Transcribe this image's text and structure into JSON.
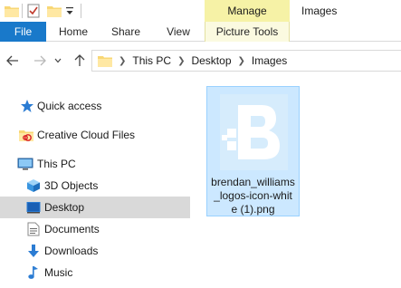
{
  "window": {
    "title": "Images",
    "contextual_group": "Manage"
  },
  "quick_access_toolbar": {
    "items": [
      "folder-icon",
      "properties-check-icon",
      "new-folder-icon",
      "customize-dropdown-icon"
    ]
  },
  "ribbon": {
    "tabs": [
      {
        "label": "File",
        "active": true
      },
      {
        "label": "Home"
      },
      {
        "label": "Share"
      },
      {
        "label": "View"
      },
      {
        "label": "Picture Tools"
      }
    ]
  },
  "address_bar": {
    "breadcrumbs": [
      "This PC",
      "Desktop",
      "Images"
    ]
  },
  "nav_pane": {
    "items": [
      {
        "label": "Quick access",
        "icon": "star-icon"
      },
      {
        "label": "Creative Cloud Files",
        "icon": "creative-cloud-folder-icon"
      },
      {
        "label": "This PC",
        "icon": "computer-icon"
      },
      {
        "label": "3D Objects",
        "icon": "cube-icon"
      },
      {
        "label": "Desktop",
        "icon": "desktop-icon",
        "selected": true
      },
      {
        "label": "Documents",
        "icon": "document-icon"
      },
      {
        "label": "Downloads",
        "icon": "download-icon"
      },
      {
        "label": "Music",
        "icon": "music-icon"
      }
    ]
  },
  "content": {
    "files": [
      {
        "name": "brendan_williams_logos-icon-white (1).png",
        "name_lines": [
          "brendan_williams",
          "_logos-icon-whit",
          "e (1).png"
        ],
        "selected": true
      }
    ]
  },
  "colors": {
    "file_tab": "#1979ca",
    "manage_tab": "#f6f2a6",
    "selection_fill": "#cce8ff",
    "selection_border": "#99d1ff",
    "nav_selected": "#d9d9d9"
  }
}
